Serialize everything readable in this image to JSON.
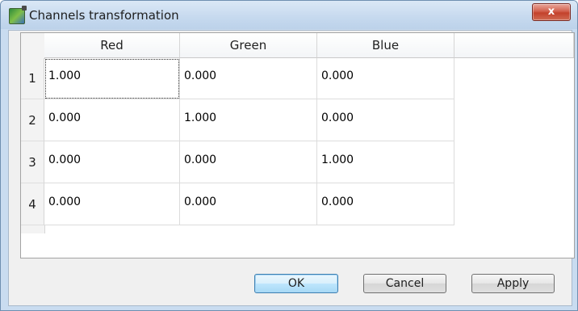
{
  "window": {
    "title": "Channels transformation",
    "close_symbol": "x"
  },
  "table": {
    "columns": [
      "Red",
      "Green",
      "Blue"
    ],
    "rows": [
      {
        "label": "1",
        "values": [
          "1.000",
          "0.000",
          "0.000"
        ]
      },
      {
        "label": "2",
        "values": [
          "0.000",
          "1.000",
          "0.000"
        ]
      },
      {
        "label": "3",
        "values": [
          "0.000",
          "0.000",
          "1.000"
        ]
      },
      {
        "label": "4",
        "values": [
          "0.000",
          "0.000",
          "0.000"
        ]
      }
    ]
  },
  "buttons": {
    "ok": "OK",
    "cancel": "Cancel",
    "apply": "Apply"
  }
}
